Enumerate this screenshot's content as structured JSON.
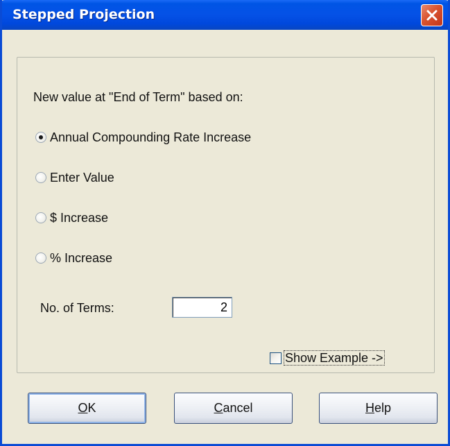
{
  "window": {
    "title": "Stepped Projection"
  },
  "prompt_label": "New value at \"End of Term\" based on:",
  "options": [
    {
      "label": "Annual Compounding Rate Increase",
      "selected": true
    },
    {
      "label": "Enter Value",
      "selected": false
    },
    {
      "label": "$ Increase",
      "selected": false
    },
    {
      "label": "% Increase",
      "selected": false
    }
  ],
  "terms": {
    "label": "No. of Terms:",
    "value": "2"
  },
  "show_example": {
    "label": "Show Example ->",
    "checked": false
  },
  "buttons": {
    "ok": {
      "mnemonic": "O",
      "rest": "K"
    },
    "cancel": {
      "mnemonic": "C",
      "rest": "ancel"
    },
    "help": {
      "mnemonic": "H",
      "rest": "elp"
    }
  },
  "colors": {
    "titlebar": "#0055E5",
    "window_bg": "#ECE9D8",
    "close_button": "#D9532F"
  }
}
